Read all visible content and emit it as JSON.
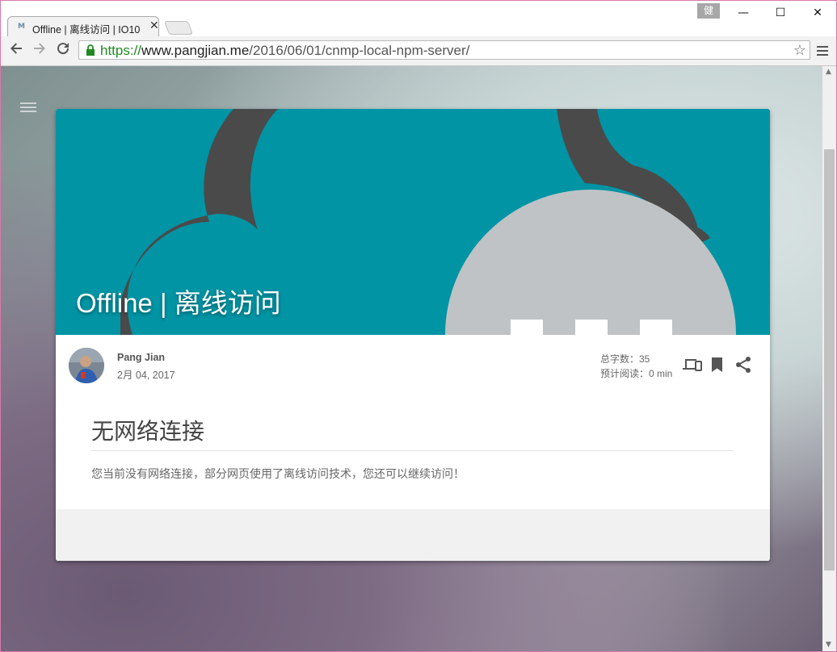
{
  "browser": {
    "tab_title": "Offline | 离线访问 | IO10",
    "tab_favicon": "M",
    "tab_close": "✕",
    "user_badge": "健",
    "window_controls": {
      "minimize": "—",
      "maximize": "☐",
      "close": "✕"
    },
    "url": {
      "scheme": "https://",
      "host": "www.pangjian.me",
      "path": "/2016/06/01/cnmp-local-npm-server/"
    },
    "icons": {
      "back": "arrow-left-icon",
      "forward": "arrow-right-icon",
      "reload": "reload-icon",
      "lock": "lock-icon",
      "star": "star-icon",
      "menu": "menu-icon"
    }
  },
  "page": {
    "hero_title": "Offline | 离线访问",
    "author": "Pang Jian",
    "date": "2月 04, 2017",
    "word_count": "总字数：35",
    "read_time": "预计阅读：0 min",
    "content_title": "无网络连接",
    "content_text": "您当前没有网络连接，部分网页使用了离线访问技术，您还可以继续访问！",
    "colors": {
      "hero": "#0094a4",
      "cloud": "#4a4a4a",
      "plug": "#bfc3c6"
    }
  }
}
